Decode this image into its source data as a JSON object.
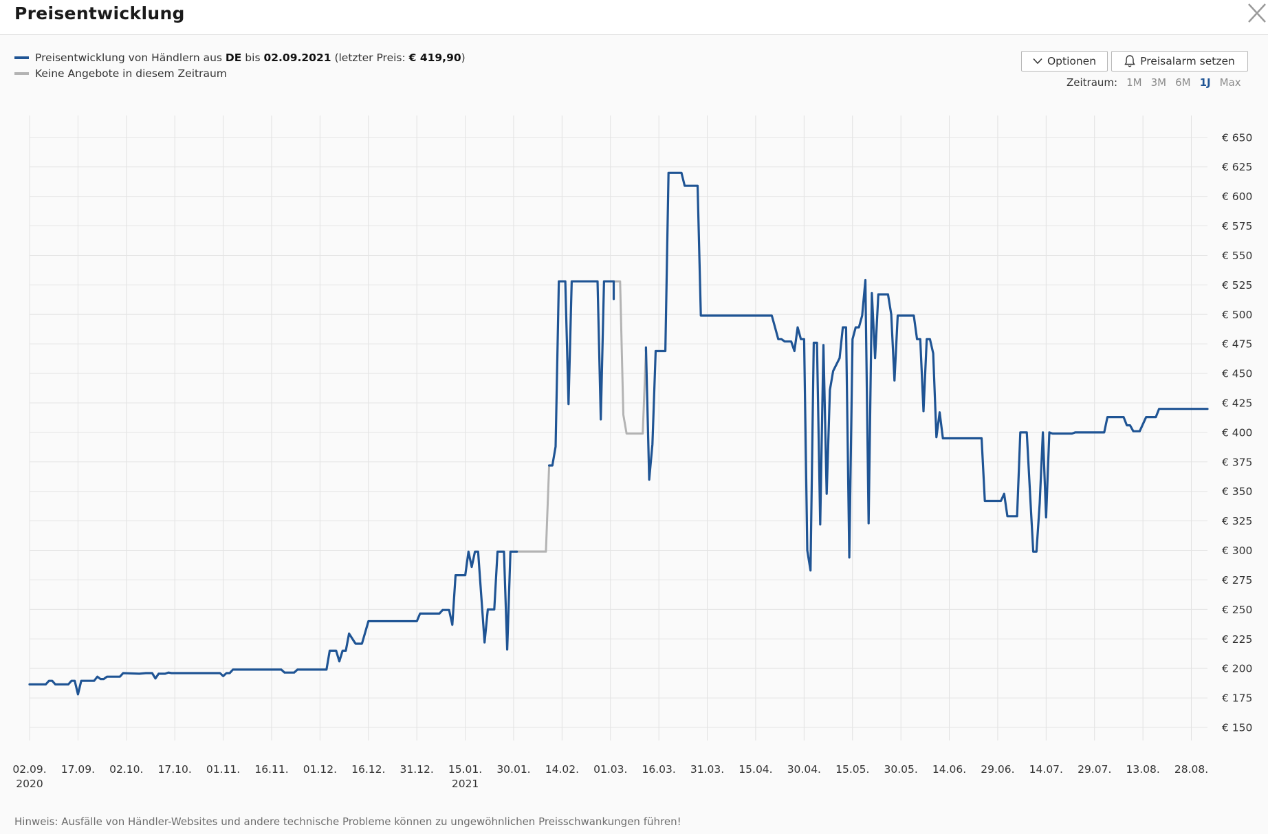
{
  "header": {
    "title": "Preisentwicklung",
    "close_icon": "close-icon"
  },
  "legend": {
    "line1": {
      "prefix": "Preisentwicklung von Händlern aus ",
      "country": "DE",
      "mid": " bis ",
      "date": "02.09.2021",
      "suffix_open": " (letzter Preis: ",
      "price": "€ 419,90",
      "suffix_close": ")",
      "color": "#1f5494"
    },
    "line2": {
      "text": "Keine Angebote in diesem Zeitraum",
      "color": "#b3b3b3"
    }
  },
  "toolbar": {
    "options_label": "Optionen",
    "options_icon": "chevron-down-icon",
    "alarm_label": "Preisalarm setzen",
    "alarm_icon": "bell-icon"
  },
  "range": {
    "label": "Zeitraum:",
    "options": [
      "1M",
      "3M",
      "6M",
      "1J",
      "Max"
    ],
    "selected": "1J"
  },
  "note": "Hinweis: Ausfälle von Händler-Websites und andere technische Probleme können zu ungewöhnlichen Preisschwankungen führen!",
  "chart_data": {
    "type": "line",
    "title": "",
    "xlabel": "",
    "ylabel": "",
    "x_range": [
      "2020-09-02",
      "2021-09-02"
    ],
    "ylim": [
      130,
      670
    ],
    "y_ticks": [
      150,
      175,
      200,
      225,
      250,
      275,
      300,
      325,
      350,
      375,
      400,
      425,
      450,
      475,
      500,
      525,
      550,
      575,
      600,
      625,
      650
    ],
    "y_tick_labels": [
      "€ 150",
      "€ 175",
      "€ 200",
      "€ 225",
      "€ 250",
      "€ 275",
      "€ 300",
      "€ 325",
      "€ 350",
      "€ 375",
      "€ 400",
      "€ 425",
      "€ 450",
      "€ 475",
      "€ 500",
      "€ 525",
      "€ 550",
      "€ 575",
      "€ 600",
      "€ 625",
      "€ 650"
    ],
    "y_axis_side": "right",
    "x_ticks": [
      {
        "date": "2020-09-02",
        "label": "02.09.",
        "year": "2020"
      },
      {
        "date": "2020-09-17",
        "label": "17.09."
      },
      {
        "date": "2020-10-02",
        "label": "02.10."
      },
      {
        "date": "2020-10-17",
        "label": "17.10."
      },
      {
        "date": "2020-11-01",
        "label": "01.11."
      },
      {
        "date": "2020-11-16",
        "label": "16.11."
      },
      {
        "date": "2020-12-01",
        "label": "01.12."
      },
      {
        "date": "2020-12-16",
        "label": "16.12."
      },
      {
        "date": "2020-12-31",
        "label": "31.12."
      },
      {
        "date": "2021-01-15",
        "label": "15.01.",
        "year": "2021"
      },
      {
        "date": "2021-01-30",
        "label": "30.01."
      },
      {
        "date": "2021-02-14",
        "label": "14.02."
      },
      {
        "date": "2021-03-01",
        "label": "01.03."
      },
      {
        "date": "2021-03-16",
        "label": "16.03."
      },
      {
        "date": "2021-03-31",
        "label": "31.03."
      },
      {
        "date": "2021-04-15",
        "label": "15.04."
      },
      {
        "date": "2021-04-30",
        "label": "30.04."
      },
      {
        "date": "2021-05-15",
        "label": "15.05."
      },
      {
        "date": "2021-05-30",
        "label": "30.05."
      },
      {
        "date": "2021-06-14",
        "label": "14.06."
      },
      {
        "date": "2021-06-29",
        "label": "29.06."
      },
      {
        "date": "2021-07-14",
        "label": "14.07."
      },
      {
        "date": "2021-07-29",
        "label": "29.07."
      },
      {
        "date": "2021-08-13",
        "label": "13.08."
      },
      {
        "date": "2021-08-28",
        "label": "28.08."
      }
    ],
    "grid": true,
    "series": [
      {
        "kind": "offers",
        "color": "#1f5494",
        "segments": [
          [
            [
              "2020-09-02",
              186.5
            ],
            [
              "2020-09-07",
              186.5
            ],
            [
              "2020-09-08",
              189.5
            ],
            [
              "2020-09-09",
              189.5
            ],
            [
              "2020-09-10",
              186.5
            ],
            [
              "2020-09-14",
              186.5
            ],
            [
              "2020-09-15",
              189.5
            ],
            [
              "2020-09-16",
              189.5
            ],
            [
              "2020-09-17",
              178
            ],
            [
              "2020-09-18",
              189.5
            ],
            [
              "2020-09-22",
              189.5
            ],
            [
              "2020-09-23",
              193
            ],
            [
              "2020-09-24",
              191
            ],
            [
              "2020-09-25",
              191
            ],
            [
              "2020-09-26",
              193
            ],
            [
              "2020-09-30",
              193
            ],
            [
              "2020-10-01",
              196
            ],
            [
              "2020-10-06",
              195.5
            ],
            [
              "2020-10-08",
              196
            ],
            [
              "2020-10-10",
              196
            ],
            [
              "2020-10-11",
              191.5
            ],
            [
              "2020-10-12",
              195.5
            ],
            [
              "2020-10-14",
              195.5
            ],
            [
              "2020-10-15",
              196.5
            ],
            [
              "2020-10-16",
              196
            ],
            [
              "2020-10-31",
              196
            ],
            [
              "2020-11-01",
              193.5
            ],
            [
              "2020-11-02",
              196
            ],
            [
              "2020-11-03",
              196
            ],
            [
              "2020-11-04",
              199
            ],
            [
              "2020-11-19",
              199
            ],
            [
              "2020-11-20",
              196.5
            ],
            [
              "2020-11-23",
              196.5
            ],
            [
              "2020-11-24",
              199
            ],
            [
              "2020-12-03",
              199
            ],
            [
              "2020-12-04",
              215
            ],
            [
              "2020-12-06",
              215
            ],
            [
              "2020-12-07",
              206
            ],
            [
              "2020-12-08",
              215
            ],
            [
              "2020-12-09",
              215
            ],
            [
              "2020-12-10",
              229.5
            ],
            [
              "2020-12-12",
              221
            ],
            [
              "2020-12-14",
              221
            ],
            [
              "2020-12-16",
              240
            ],
            [
              "2020-12-31",
              240
            ],
            [
              "2021-01-01",
              246.5
            ],
            [
              "2021-01-07",
              246.5
            ],
            [
              "2021-01-08",
              249.5
            ],
            [
              "2021-01-10",
              249.5
            ],
            [
              "2021-01-11",
              237
            ],
            [
              "2021-01-12",
              279
            ],
            [
              "2021-01-15",
              279
            ],
            [
              "2021-01-16",
              299
            ],
            [
              "2021-01-17",
              286
            ],
            [
              "2021-01-18",
              299
            ],
            [
              "2021-01-19",
              299
            ],
            [
              "2021-01-21",
              222
            ],
            [
              "2021-01-22",
              250
            ],
            [
              "2021-01-24",
              250
            ],
            [
              "2021-01-25",
              299
            ],
            [
              "2021-01-27",
              299
            ],
            [
              "2021-01-28",
              216
            ],
            [
              "2021-01-29",
              299
            ],
            [
              "2021-01-31",
              299
            ]
          ],
          [
            [
              "2021-02-10",
              372
            ],
            [
              "2021-02-11",
              372
            ],
            [
              "2021-02-12",
              388
            ],
            [
              "2021-02-13",
              528
            ],
            [
              "2021-02-15",
              528
            ],
            [
              "2021-02-16",
              424
            ],
            [
              "2021-02-17",
              528
            ],
            [
              "2021-02-25",
              528
            ],
            [
              "2021-02-26",
              411
            ],
            [
              "2021-02-27",
              528
            ],
            [
              "2021-03-02",
              528
            ],
            [
              "2021-03-02",
              513
            ]
          ],
          [
            [
              "2021-03-12",
              469
            ],
            [
              "2021-03-12",
              472
            ],
            [
              "2021-03-13",
              360
            ],
            [
              "2021-03-14",
              390
            ],
            [
              "2021-03-15",
              469
            ],
            [
              "2021-03-18",
              469
            ],
            [
              "2021-03-19",
              620
            ],
            [
              "2021-03-23",
              620
            ],
            [
              "2021-03-24",
              609
            ],
            [
              "2021-03-28",
              609
            ],
            [
              "2021-03-29",
              499
            ],
            [
              "2021-04-20",
              499
            ],
            [
              "2021-04-21",
              489
            ],
            [
              "2021-04-22",
              479
            ],
            [
              "2021-04-23",
              479
            ],
            [
              "2021-04-24",
              477
            ],
            [
              "2021-04-26",
              477
            ],
            [
              "2021-04-27",
              469
            ],
            [
              "2021-04-28",
              489
            ],
            [
              "2021-04-29",
              479
            ],
            [
              "2021-04-30",
              479
            ],
            [
              "2021-05-01",
              300
            ],
            [
              "2021-05-02",
              283
            ],
            [
              "2021-05-03",
              476
            ],
            [
              "2021-05-04",
              476
            ],
            [
              "2021-05-05",
              322
            ],
            [
              "2021-05-06",
              474
            ],
            [
              "2021-05-07",
              348
            ],
            [
              "2021-05-08",
              436
            ],
            [
              "2021-05-09",
              452
            ],
            [
              "2021-05-11",
              463
            ],
            [
              "2021-05-12",
              489
            ],
            [
              "2021-05-13",
              489
            ],
            [
              "2021-05-14",
              294
            ],
            [
              "2021-05-15",
              479
            ],
            [
              "2021-05-16",
              489
            ],
            [
              "2021-05-17",
              489
            ],
            [
              "2021-05-18",
              499
            ],
            [
              "2021-05-19",
              529
            ],
            [
              "2021-05-20",
              323
            ],
            [
              "2021-05-21",
              518
            ],
            [
              "2021-05-22",
              463
            ],
            [
              "2021-05-23",
              517
            ],
            [
              "2021-05-26",
              517
            ],
            [
              "2021-05-27",
              500
            ],
            [
              "2021-05-28",
              444
            ],
            [
              "2021-05-29",
              499
            ],
            [
              "2021-06-03",
              499
            ],
            [
              "2021-06-04",
              479
            ],
            [
              "2021-06-05",
              479
            ],
            [
              "2021-06-06",
              418
            ],
            [
              "2021-06-07",
              479
            ],
            [
              "2021-06-08",
              479
            ],
            [
              "2021-06-09",
              467
            ],
            [
              "2021-06-10",
              396
            ],
            [
              "2021-06-11",
              417
            ],
            [
              "2021-06-12",
              395
            ],
            [
              "2021-06-24",
              395
            ],
            [
              "2021-06-25",
              342
            ],
            [
              "2021-06-30",
              342
            ],
            [
              "2021-07-01",
              348
            ],
            [
              "2021-07-02",
              329
            ],
            [
              "2021-07-05",
              329
            ],
            [
              "2021-07-06",
              400
            ],
            [
              "2021-07-08",
              400
            ],
            [
              "2021-07-09",
              349
            ],
            [
              "2021-07-10",
              299
            ],
            [
              "2021-07-11",
              299
            ],
            [
              "2021-07-12",
              340
            ],
            [
              "2021-07-13",
              400
            ],
            [
              "2021-07-14",
              328
            ],
            [
              "2021-07-15",
              400
            ],
            [
              "2021-07-16",
              399
            ],
            [
              "2021-07-22",
              399
            ],
            [
              "2021-07-23",
              400
            ],
            [
              "2021-08-01",
              400
            ],
            [
              "2021-08-02",
              413
            ],
            [
              "2021-08-07",
              413
            ],
            [
              "2021-08-08",
              406
            ],
            [
              "2021-08-09",
              406
            ],
            [
              "2021-08-10",
              401
            ],
            [
              "2021-08-12",
              401
            ],
            [
              "2021-08-14",
              413
            ],
            [
              "2021-08-17",
              413
            ],
            [
              "2021-08-18",
              419.9
            ],
            [
              "2021-09-02",
              419.9
            ]
          ]
        ]
      },
      {
        "kind": "no-offers",
        "color": "#b3b3b3",
        "segments": [
          [
            [
              "2021-01-31",
              299
            ],
            [
              "2021-02-02",
              299
            ],
            [
              "2021-02-09",
              299
            ],
            [
              "2021-02-10",
              372
            ]
          ],
          [
            [
              "2021-03-02",
              513
            ],
            [
              "2021-03-02",
              528
            ],
            [
              "2021-03-04",
              528
            ],
            [
              "2021-03-05",
              415
            ],
            [
              "2021-03-06",
              399
            ],
            [
              "2021-03-11",
              399
            ],
            [
              "2021-03-12",
              469
            ]
          ]
        ]
      }
    ]
  }
}
